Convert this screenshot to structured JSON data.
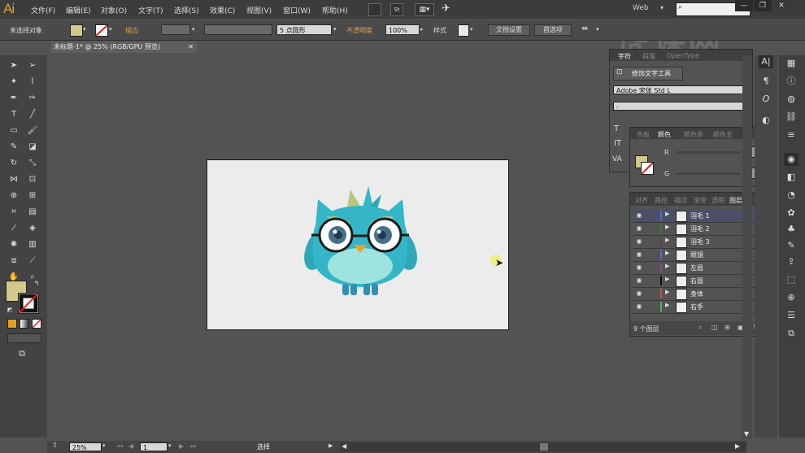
{
  "app": {
    "logo": "Ai"
  },
  "menubar": {
    "items": [
      "文件(F)",
      "编辑(E)",
      "对象(O)",
      "文字(T)",
      "选择(S)",
      "效果(C)",
      "视图(V)",
      "窗口(W)",
      "帮助(H)"
    ],
    "workspace": "Web",
    "search_placeholder": "",
    "win_min": "—",
    "win_max": "❐",
    "win_close": "✕"
  },
  "watermark": "虎课网",
  "controlbar": {
    "selection_label": "未选择对象",
    "stroke_label": "描边",
    "brush_value": "5 点圆形",
    "opacity_label": "不透明度",
    "opacity_value": "100%",
    "style_label": "样式",
    "doc_setup": "文档设置",
    "preferences": "首选项"
  },
  "document": {
    "tab_title": "未标题-1* @ 25% (RGB/GPU 预览)",
    "zoom": "25%",
    "artboard": "1",
    "status": "选择"
  },
  "character_panel": {
    "tabs": [
      "字符",
      "段落",
      "OpenType"
    ],
    "touch_tool": "修饰文字工具",
    "font_family": "Adobe 宋体 Std L",
    "font_style": "-"
  },
  "color_panel": {
    "tabs": [
      "色板",
      "颜色",
      "颜色参",
      "颜色主"
    ],
    "channel_r": "R",
    "channel_g": "G"
  },
  "layers_panel": {
    "tabs": [
      "对齐",
      "路径",
      "描边",
      "渐变",
      "透明",
      "图层"
    ],
    "footer_count": "9 个图层",
    "layers": [
      {
        "name": "羽毛 1",
        "color": "#4f6bdc"
      },
      {
        "name": "羽毛 2",
        "color": "#3f7a3f"
      },
      {
        "name": "羽毛 3",
        "color": "#6b3f3f"
      },
      {
        "name": "眼镜",
        "color": "#4f6bdc"
      },
      {
        "name": "左眉",
        "color": "#8a4a8a"
      },
      {
        "name": "右眉",
        "color": "#111111"
      },
      {
        "name": "身体",
        "color": "#d24a4a"
      },
      {
        "name": "右手",
        "color": "#43b84a"
      }
    ]
  },
  "colors": {
    "fill": "#d0c98a",
    "owl_body": "#35b6c8",
    "owl_belly": "#9fe3de",
    "owl_beak": "#e7a227"
  }
}
